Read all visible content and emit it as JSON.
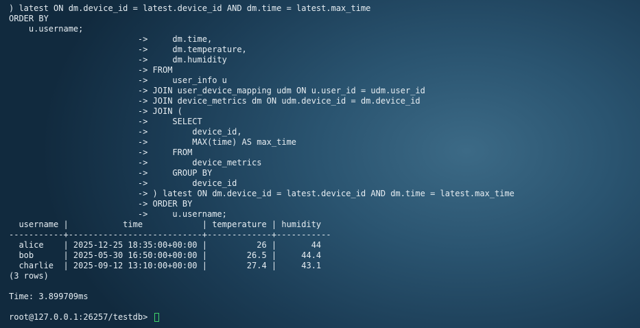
{
  "terminal": {
    "lines": [
      ") latest ON dm.device_id = latest.device_id AND dm.time = latest.max_time",
      "ORDER BY",
      "    u.username;",
      "                          ->     dm.time,",
      "                          ->     dm.temperature,",
      "                          ->     dm.humidity",
      "                          -> FROM",
      "                          ->     user_info u",
      "                          -> JOIN user_device_mapping udm ON u.user_id = udm.user_id",
      "                          -> JOIN device_metrics dm ON udm.device_id = dm.device_id",
      "                          -> JOIN (",
      "                          ->     SELECT",
      "                          ->         device_id,",
      "                          ->         MAX(time) AS max_time",
      "                          ->     FROM",
      "                          ->         device_metrics",
      "                          ->     GROUP BY",
      "                          ->         device_id",
      "                          -> ) latest ON dm.device_id = latest.device_id AND dm.time = latest.max_time",
      "                          -> ORDER BY",
      "                          ->     u.username;",
      "  username |           time            | temperature | humidity",
      "-----------+---------------------------+-------------+-----------",
      "  alice    | 2025-12-25 18:35:00+00:00 |          26 |       44",
      "  bob      | 2025-05-30 16:50:00+00:00 |        26.5 |     44.4",
      "  charlie  | 2025-09-12 13:10:00+00:00 |        27.4 |     43.1",
      "(3 rows)",
      "",
      "Time: 3.899709ms",
      ""
    ],
    "prompt": "root@127.0.0.1:26257/testdb> "
  }
}
